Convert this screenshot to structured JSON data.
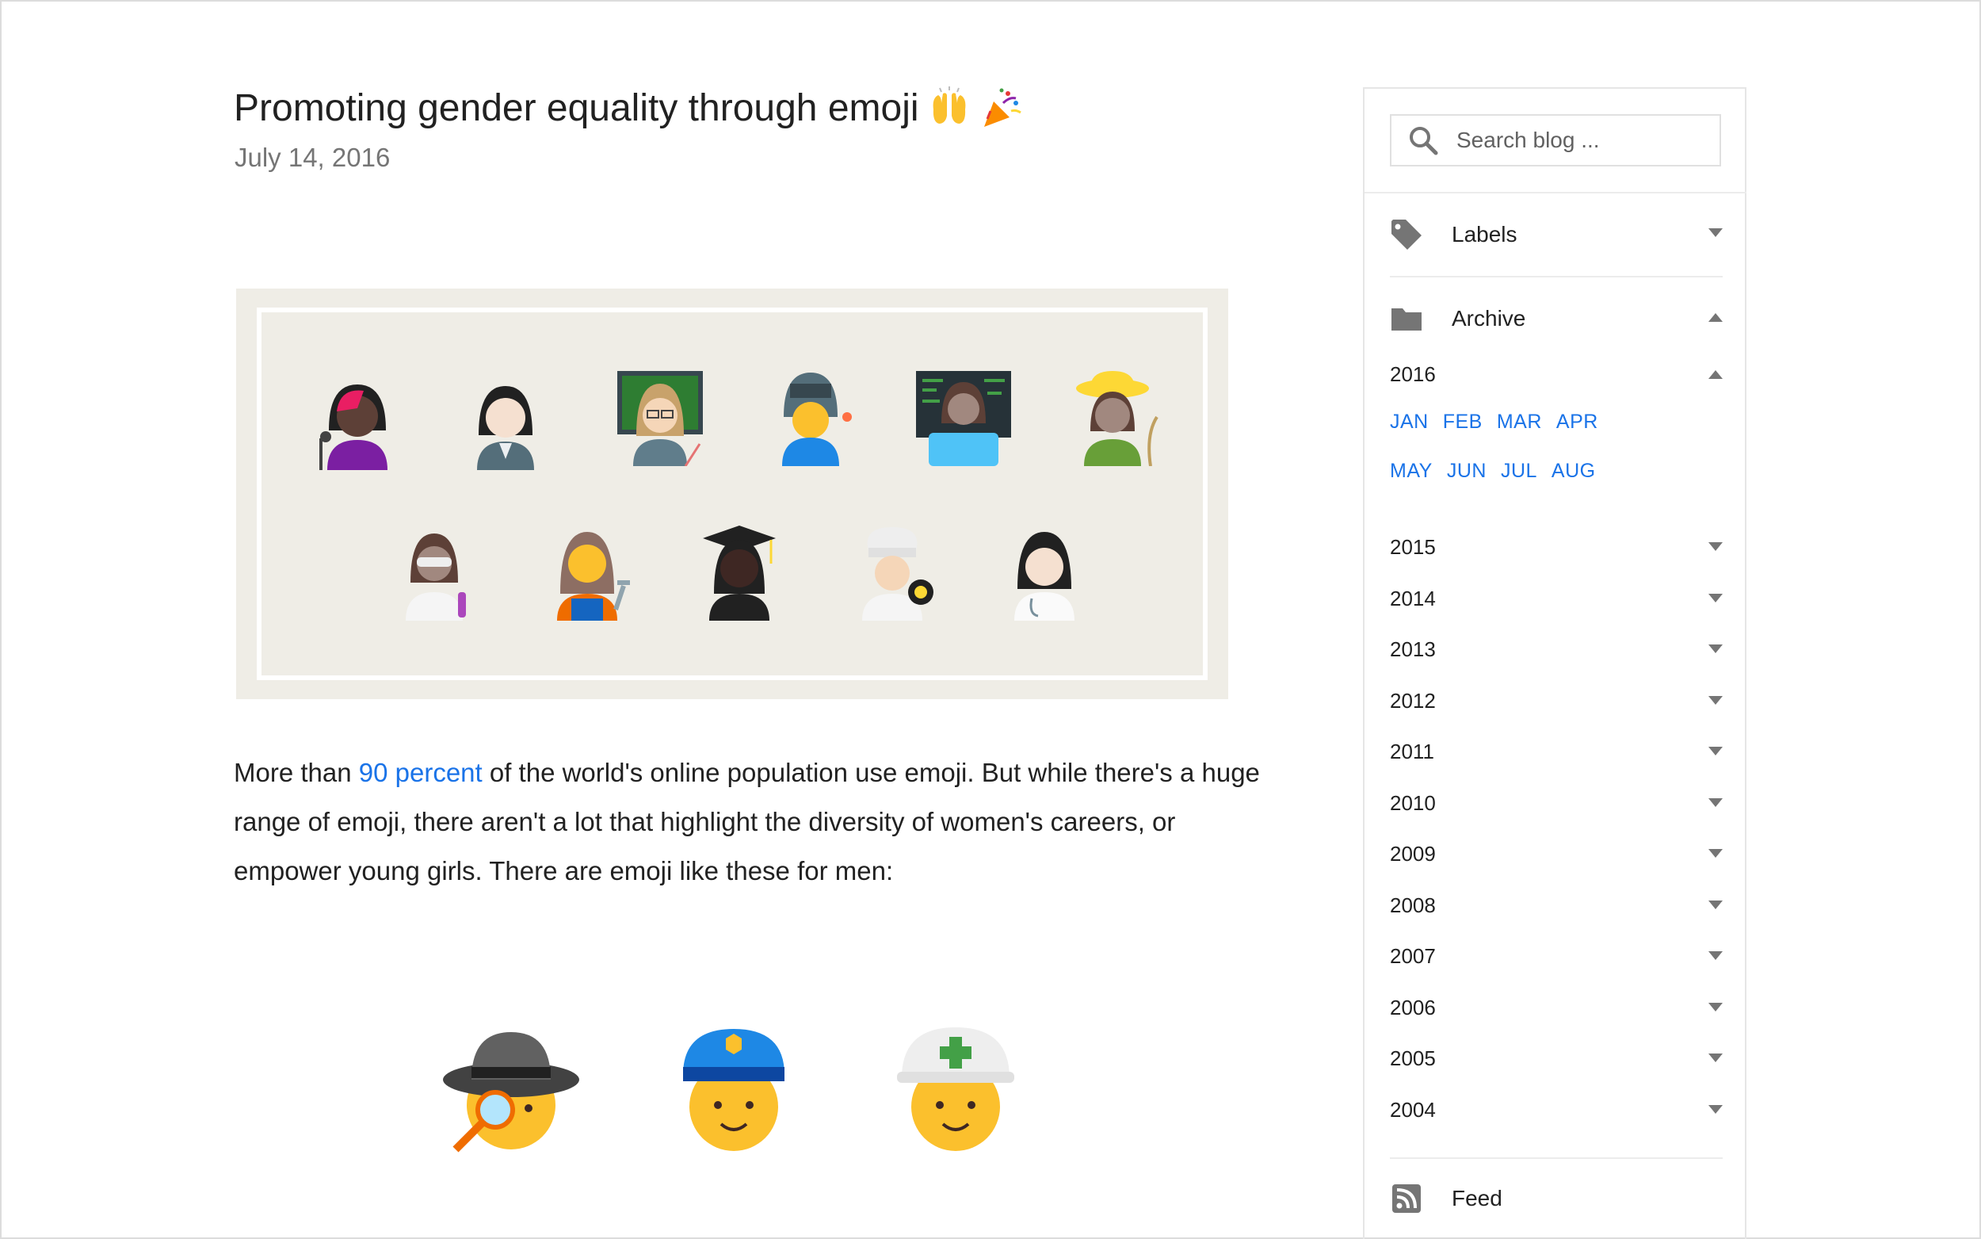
{
  "post": {
    "title": "Promoting gender equality through emoji",
    "title_emojis": [
      "raising-hands-icon",
      "party-popper-icon"
    ],
    "date": "July 14, 2016",
    "hero_figures_row1": [
      "woman-singer-icon",
      "woman-office-worker-icon",
      "woman-teacher-icon",
      "woman-welder-icon",
      "woman-technologist-icon",
      "woman-farmer-icon"
    ],
    "hero_figures_row2": [
      "woman-scientist-icon",
      "woman-mechanic-icon",
      "woman-graduate-icon",
      "woman-cook-icon",
      "woman-doctor-icon"
    ],
    "body": {
      "before_link": "More than ",
      "link_text": "90 percent",
      "after_link": " of the world's online population use emoji. But while there's a huge range of emoji, there aren't a lot that highlight the diversity of women's careers, or empower young girls. There are emoji like these for men:"
    },
    "men_emojis": [
      "detective-icon",
      "police-officer-icon",
      "construction-worker-icon"
    ]
  },
  "sidebar": {
    "search": {
      "placeholder": "Search blog ..."
    },
    "labels": {
      "label": "Labels",
      "icon": "tag-icon",
      "state": "collapsed"
    },
    "archive": {
      "label": "Archive",
      "icon": "folder-icon",
      "state": "expanded"
    },
    "years": [
      {
        "year": "2016",
        "state": "expanded"
      },
      {
        "year": "2015",
        "state": "collapsed"
      },
      {
        "year": "2014",
        "state": "collapsed"
      },
      {
        "year": "2013",
        "state": "collapsed"
      },
      {
        "year": "2012",
        "state": "collapsed"
      },
      {
        "year": "2011",
        "state": "collapsed"
      },
      {
        "year": "2010",
        "state": "collapsed"
      },
      {
        "year": "2009",
        "state": "collapsed"
      },
      {
        "year": "2008",
        "state": "collapsed"
      },
      {
        "year": "2007",
        "state": "collapsed"
      },
      {
        "year": "2006",
        "state": "collapsed"
      },
      {
        "year": "2005",
        "state": "collapsed"
      },
      {
        "year": "2004",
        "state": "collapsed"
      }
    ],
    "months_2016": [
      "JAN",
      "FEB",
      "MAR",
      "APR",
      "MAY",
      "JUN",
      "JUL",
      "AUG"
    ],
    "feed": {
      "label": "Feed",
      "icon": "rss-feed-icon"
    }
  },
  "colors": {
    "link": "#1a73e8",
    "icon_grey": "#757575",
    "hero_bg": "#efede6"
  }
}
